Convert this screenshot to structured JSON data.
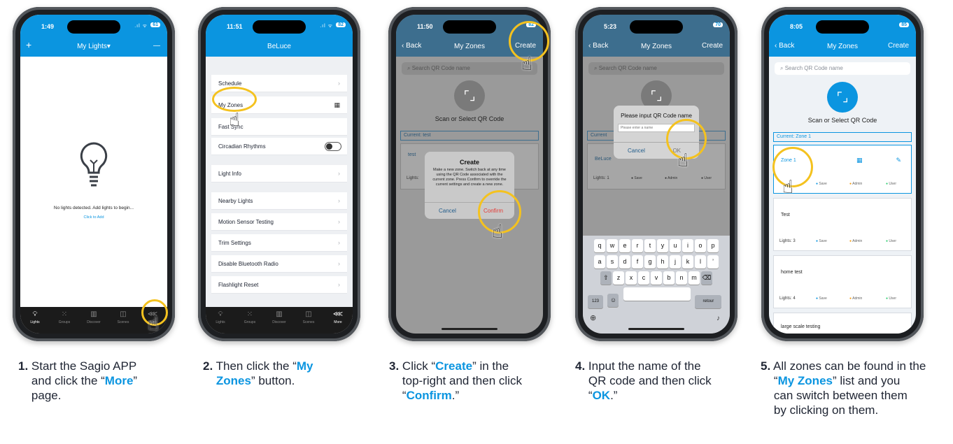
{
  "phones": [
    {
      "time": "1:49",
      "battery": "61",
      "nav": {
        "title": "My Lights▾",
        "left": "+",
        "right": "—"
      },
      "empty": {
        "message": "No lights detected. Add lights to begin...",
        "link": "Click to Add"
      },
      "tabs": [
        "Lights",
        "Groups",
        "Discover",
        "Scenes",
        "More"
      ]
    },
    {
      "time": "11:51",
      "battery": "82",
      "nav": {
        "title": "BeLuce"
      },
      "menu": [
        "Schedule",
        "My Zones",
        "Fast Sync",
        "Circadian Rhythms",
        "Light Info",
        "Nearby Lights",
        "Motion Sensor Testing",
        "Trim Settings",
        "Disable Bluetooth Radio",
        "Flashlight Reset"
      ],
      "tabs": [
        "Lights",
        "Groups",
        "Discover",
        "Scenes",
        "More"
      ]
    },
    {
      "time": "11:50",
      "battery": "82",
      "nav": {
        "back": "Back",
        "title": "My Zones",
        "right": "Create"
      },
      "search": "Search QR Code name",
      "scan": "Scan or Select QR Code",
      "current": "Current: test",
      "zone": "test",
      "lights": "Lights:",
      "dialog": {
        "title": "Create",
        "body": "Make a new zone. Switch back at any time using the QR Code associated with the current zone. Press Confirm to override the current settings and create a new zone.",
        "cancel": "Cancel",
        "confirm": "Confirm"
      }
    },
    {
      "time": "5:23",
      "battery": "70",
      "nav": {
        "back": "Back",
        "title": "My Zones",
        "right": "Create"
      },
      "search": "Search QR Code name",
      "current": "Current",
      "zone": "BeLuce",
      "lights": "Lights: 1",
      "save": "Save",
      "admin": "Admin",
      "user": "User",
      "dialog": {
        "title": "Please input QR Code name",
        "placeholder": "Please enter a name",
        "cancel": "Cancel",
        "ok": "OK"
      },
      "keys": {
        "row1": [
          "q",
          "w",
          "e",
          "r",
          "t",
          "y",
          "u",
          "i",
          "o",
          "p"
        ],
        "row2": [
          "a",
          "s",
          "d",
          "f",
          "g",
          "h",
          "j",
          "k",
          "l",
          "’"
        ],
        "row3": [
          "z",
          "x",
          "c",
          "v",
          "b",
          "n",
          "m"
        ],
        "num": "123",
        "ret": "retour"
      }
    },
    {
      "time": "8:05",
      "battery": "85",
      "nav": {
        "back": "Back",
        "title": "My Zones",
        "right": "Create"
      },
      "search": "Search QR Code name",
      "scan": "Scan or Select QR Code",
      "current": "Current:  Zone 1",
      "zones": [
        {
          "name": "Zone 1",
          "lights": ""
        },
        {
          "name": "Test",
          "lights": "Lights: 3"
        },
        {
          "name": "home test",
          "lights": "Lights: 4"
        },
        {
          "name": "large scale testing",
          "lights": ""
        }
      ],
      "save": "Save",
      "admin": "Admin",
      "user": "User"
    }
  ],
  "captions": [
    {
      "num": "1.",
      "l1": "Start the Sagio APP",
      "l2a": "and click the  “",
      "hl": "More",
      "l2b": "”",
      "l3": "page."
    },
    {
      "num": "2.",
      "l1a": "Then click the “",
      "hl1": "My",
      "hl2": "Zones",
      "l2b": "” button."
    },
    {
      "num": "3.",
      "l1a": "Click “",
      "hl": "Create",
      "l1b": "” in the",
      "l2": "top-right and then click",
      "l3a": "“",
      "hl2": "Confirm",
      "l3b": ".”"
    },
    {
      "num": "4.",
      "l1": "Input the name of the",
      "l2": "QR code and then click",
      "l3a": "“",
      "hl": "OK",
      "l3b": ".”"
    },
    {
      "num": "5.",
      "l1": "All zones can be found in the",
      "l2a": "“",
      "hl": "My Zones",
      "l2b": "” list  and you",
      "l3": "can switch between them",
      "l4": "by clicking on them."
    }
  ],
  "colors": {
    "accent": "#0b95e0",
    "highlight": "#f4c21f",
    "danger": "#e53935"
  }
}
